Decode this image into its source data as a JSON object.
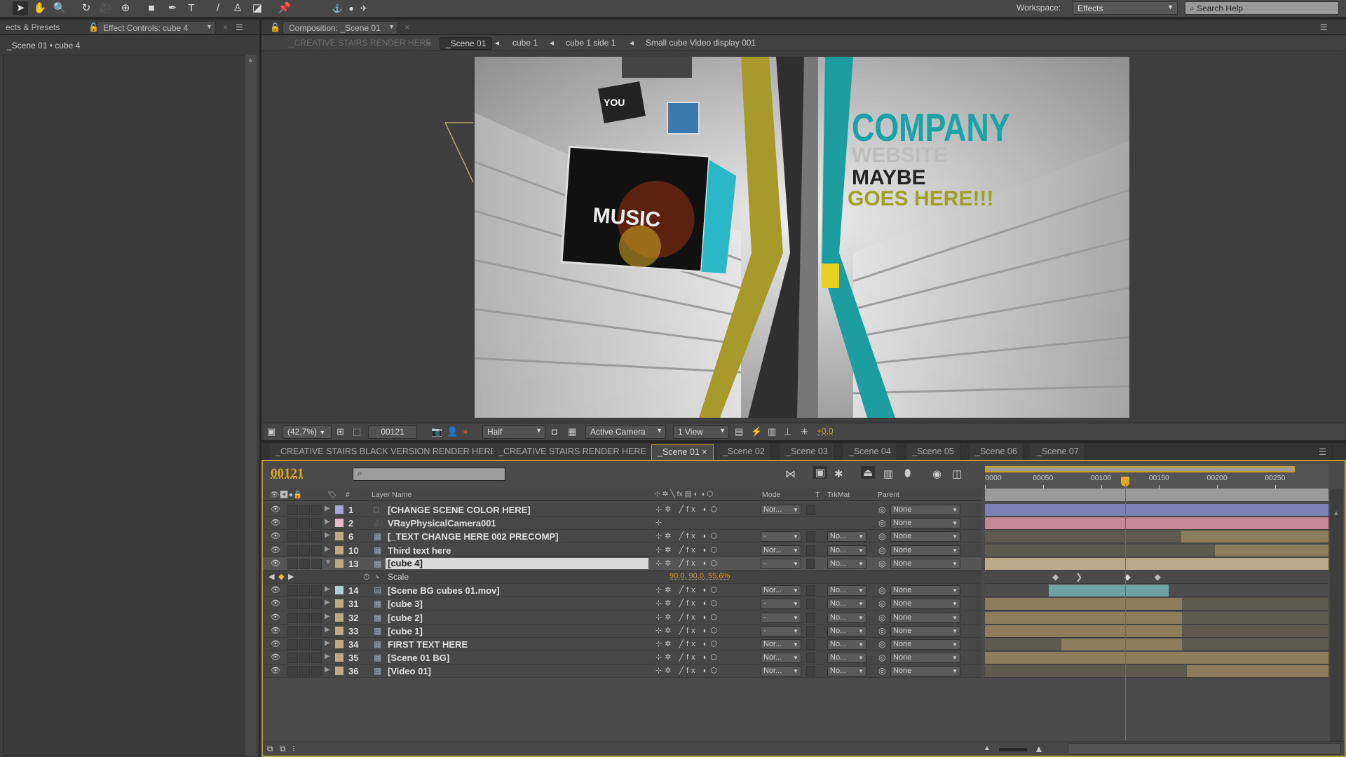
{
  "toolbar": {
    "tools": [
      "selection-tool",
      "hand-tool",
      "zoom-tool",
      "rotation-tool",
      "camera-tool",
      "pan-behind-tool",
      "rectangle-tool",
      "pen-tool",
      "type-tool",
      "brush-tool",
      "clone-stamp-tool",
      "eraser-tool",
      "puppet-tool"
    ],
    "workspace_label": "Workspace:",
    "workspace_value": "Effects",
    "search_placeholder": "Search Help"
  },
  "left_panel": {
    "tab_effects": "ects & Presets",
    "tab_effect_controls": "Effect Controls: cube 4",
    "breadcrumb": "_Scene 01 • cube 4"
  },
  "comp_panel": {
    "tab": "Composition: _Scene 01",
    "breadcrumbs": [
      "_CREATIVE STAIRS RENDER HERE",
      "_Scene 01",
      "cube 1",
      "cube 1 side 1",
      "Small cube Video display 001"
    ],
    "scene_text": {
      "line1": "COMPANY",
      "line2": "WEBSITE",
      "line3": "MAYBE",
      "line4": "GOES HERE!!!",
      "music": "MUSIC",
      "you": "YOU"
    }
  },
  "viewer_toolbar": {
    "zoom": "(42,7%)",
    "frame": "00121",
    "resolution": "Half",
    "view": "Active Camera",
    "layout": "1 View",
    "exposure": "+0,0"
  },
  "timeline": {
    "tabs": [
      "_CREATIVE STAIRS BLACK VERSION RENDER HERE",
      "_CREATIVE STAIRS RENDER HERE",
      "_Scene 01",
      "_Scene 02",
      "_Scene 03",
      "_Scene 04",
      "_Scene 05",
      "_Scene 06",
      "_Scene 07"
    ],
    "active_tab": "_Scene 01",
    "current_time": "00121",
    "current_frame": 121,
    "duration_frames": 296,
    "work_area_end": 267,
    "ruler_labels": [
      {
        "frame": 0,
        "label": "0000"
      },
      {
        "frame": 50,
        "label": "00050"
      },
      {
        "frame": 100,
        "label": "00100"
      },
      {
        "frame": 150,
        "label": "00150"
      },
      {
        "frame": 200,
        "label": "00200"
      },
      {
        "frame": 250,
        "label": "00250"
      }
    ],
    "columns": {
      "name": "Layer Name",
      "num": "#",
      "mode": "Mode",
      "t": "T",
      "trkmat": "TrkMat",
      "parent": "Parent"
    },
    "layers": [
      {
        "num": "1",
        "name": "[CHANGE SCENE COLOR HERE]",
        "label": "#a9a6d6",
        "src": "solid",
        "mode": "Nor...",
        "trkmat": "",
        "parent": "None",
        "in": 0,
        "out": 296,
        "color": "#7d80b4"
      },
      {
        "num": "2",
        "name": "VRayPhysicalCamera001",
        "label": "#e6b9c7",
        "src": "camera",
        "mode": "",
        "trkmat": "",
        "parent": "None",
        "in": 0,
        "out": 296,
        "color": "#c48894"
      },
      {
        "num": "6",
        "name": "[_TEXT CHANGE HERE 002 PRECOMP]",
        "label": "#bfa982",
        "src": "comp",
        "mode": "-",
        "trkmat": "No...",
        "parent": "None",
        "in": 169,
        "out": 296,
        "color": "#8c7d5c"
      },
      {
        "num": "10",
        "name": "Third text here",
        "label": "#bfa982",
        "src": "comp",
        "mode": "Nor...",
        "trkmat": "No...",
        "parent": "None",
        "in": 198,
        "out": 296,
        "color": "#8c7d5c"
      },
      {
        "num": "13",
        "name": "[cube 4]",
        "label": "#bfa982",
        "src": "comp",
        "mode": "-",
        "trkmat": "No...",
        "parent": "None",
        "in": 0,
        "out": 296,
        "color": "#b8aa8a",
        "selected": true
      },
      {
        "num": "14",
        "name": "[Scene BG cubes 01.mov]",
        "label": "#a9d3d3",
        "src": "footage",
        "mode": "Nor...",
        "trkmat": "No...",
        "parent": "None",
        "in": 55,
        "out": 158,
        "color": "#6fa3a3"
      },
      {
        "num": "31",
        "name": "[cube 3]",
        "label": "#bfa982",
        "src": "comp",
        "mode": "-",
        "trkmat": "No...",
        "parent": "None",
        "in": 0,
        "out": 170,
        "color": "#8c7d5c"
      },
      {
        "num": "32",
        "name": "[cube 2]",
        "label": "#bfa982",
        "src": "comp",
        "mode": "-",
        "trkmat": "No...",
        "parent": "None",
        "in": 0,
        "out": 170,
        "color": "#8c7d5c"
      },
      {
        "num": "33",
        "name": "[cube 1]",
        "label": "#bfa982",
        "src": "comp",
        "mode": "-",
        "trkmat": "No...",
        "parent": "None",
        "in": 0,
        "out": 170,
        "color": "#8c7d5c"
      },
      {
        "num": "34",
        "name": "FIRST TEXT HERE",
        "label": "#bfa982",
        "src": "comp",
        "mode": "Nor...",
        "trkmat": "No...",
        "parent": "None",
        "in": 66,
        "out": 170,
        "color": "#8c7d5c"
      },
      {
        "num": "35",
        "name": "[Scene 01 BG]",
        "label": "#bfa982",
        "src": "comp",
        "mode": "Nor...",
        "trkmat": "No...",
        "parent": "None",
        "in": 0,
        "out": 296,
        "color": "#8c7d5c"
      },
      {
        "num": "36",
        "name": "[Video 01]",
        "label": "#bfa982",
        "src": "comp",
        "mode": "Nor...",
        "trkmat": "No...",
        "parent": "None",
        "in": 174,
        "out": 296,
        "color": "#8c7d5c"
      }
    ],
    "property": {
      "name": "Scale",
      "value": "90,0, 90,0, 55,6%",
      "after_layer": "13",
      "keyframes": [
        61,
        81,
        123,
        149
      ]
    }
  },
  "colors": {
    "accent": "#e0a820",
    "playhead": "#e03a2a",
    "panel_border": "#b99a2a"
  }
}
